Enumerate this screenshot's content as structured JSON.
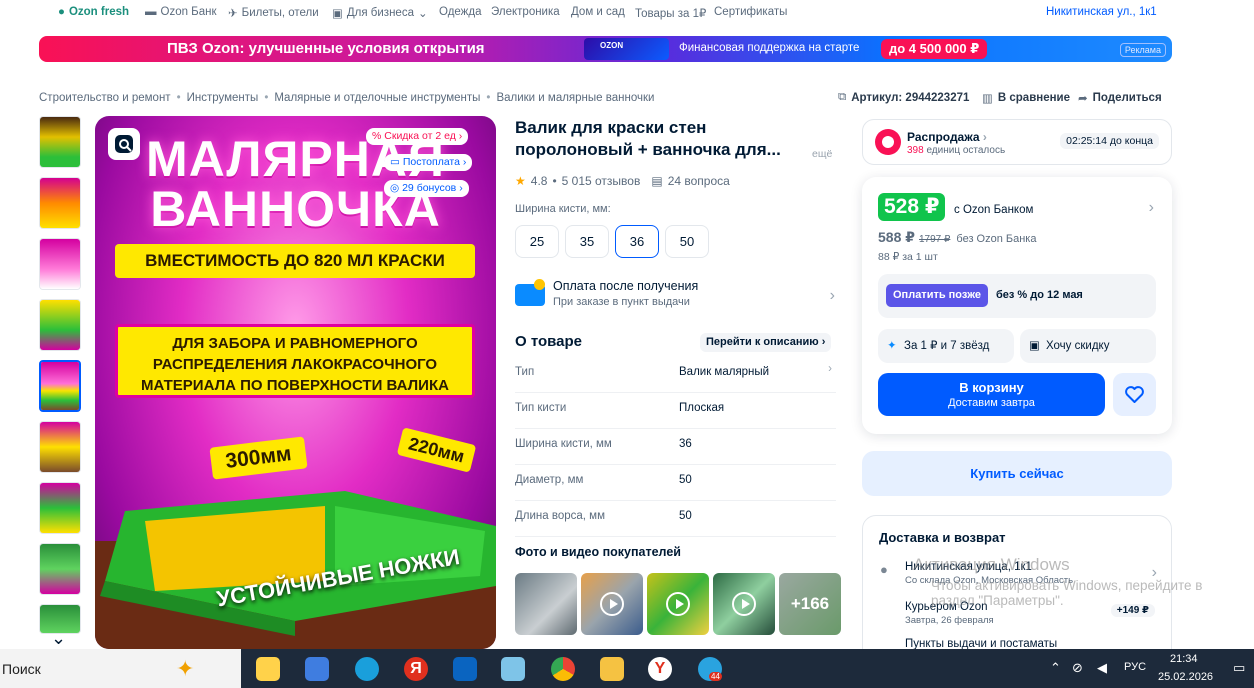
{
  "topnav": {
    "fresh": "Ozon fresh",
    "bank": "Ozon Банк",
    "tickets": "Билеты, отели",
    "business": "Для бизнеса",
    "clothes": "Одежда",
    "electronics": "Электроника",
    "home": "Дом и сад",
    "goods1": "Товары за 1₽",
    "certs": "Сертификаты",
    "address": "Никитинская ул., 1к1"
  },
  "banner": {
    "title": "ПВЗ Ozon: улучшенные условия открытия",
    "subtitle": "Финансовая поддержка на старте",
    "amount": "до 4 500 000 ₽",
    "ad": "Реклама",
    "deco": "OZON"
  },
  "breadcrumbs": [
    "Строительство и ремонт",
    "Инструменты",
    "Малярные и отделочные инструменты",
    "Валики и малярные ванночки"
  ],
  "actions": {
    "article": "Артикул: 2944223271",
    "compare": "В сравнение",
    "share": "Поделиться"
  },
  "gallery": {
    "headline1": "МАЛЯРНАЯ",
    "headline2": "ВАННОЧКА",
    "capacity": "ВМЕСТИМОСТЬ ДО 820 МЛ КРАСКИ",
    "purpose": "ДЛЯ ЗАБОРА И РАВНОМЕРНОГО РАСПРЕДЕЛЕНИЯ ЛАКОКРАСОЧНОГО МАТЕРИАЛА ПО ПОВЕРХНОСТИ ВАЛИКА",
    "size1": "300мм",
    "size2": "220мм",
    "legs": "УСТОЙЧИВЫЕ НОЖКИ",
    "tag_discount": "Скидка от 2 ед",
    "tag_postpay": "Постоплата",
    "tag_bonus": "29 бонусов"
  },
  "product": {
    "title": "Валик для краски стен поролоновый + ванночка для...",
    "more": "ещё",
    "rating": "4.8",
    "reviews": "5 015 отзывов",
    "questions": "24 вопроса",
    "width_label": "Ширина кисти, мм:",
    "sizes": [
      "25",
      "35",
      "36",
      "50"
    ],
    "pay_title": "Оплата после получения",
    "pay_sub": "При заказе в пункт выдачи",
    "about": "О товаре",
    "goto_desc": "Перейти к описанию",
    "specs": [
      {
        "k": "Тип",
        "v": "Валик малярный"
      },
      {
        "k": "Тип кисти",
        "v": "Плоская"
      },
      {
        "k": "Ширина кисти, мм",
        "v": "36"
      },
      {
        "k": "Диаметр, мм",
        "v": "50"
      },
      {
        "k": "Длина ворса, мм",
        "v": "50"
      }
    ],
    "photos_title": "Фото и видео покупателей",
    "photos_more": "+166"
  },
  "sale": {
    "title": "Распродажа",
    "left_count": "398",
    "left_text": "единиц осталось",
    "timer": "02:25:14 до конца"
  },
  "price": {
    "bank_price": "528 ₽",
    "bank_label": "с Ozon Банком",
    "price": "588 ₽",
    "old_price": "1797 ₽",
    "no_bank": "без Ozon Банка",
    "per_unit": "88 ₽ за 1 шт",
    "later_btn": "Оплатить позже",
    "later_text": "без % до 12 мая",
    "stars": "За 1 ₽ и 7 звёзд",
    "discount": "Хочу скидку",
    "cart": "В корзину",
    "cart_sub": "Доставим завтра",
    "buy_now": "Купить сейчас"
  },
  "delivery": {
    "title": "Доставка и возврат",
    "address": "Никитинская улица, 1к1",
    "address_sub": "Со склада Ozon, Московская Область",
    "courier": "Курьером Ozon",
    "courier_sub": "Завтра, 26 февраля",
    "courier_price": "+149 ₽",
    "pickup": "Пункты выдачи и постаматы"
  },
  "watermark": {
    "t1": "Активация Windows",
    "t2": "Чтобы активировать Windows, перейдите в",
    "t3": "раздел \"Параметры\"."
  },
  "taskbar": {
    "search": "Поиск",
    "lang": "РУС",
    "time": "21:34",
    "date": "25.02.2026",
    "badge": "44"
  }
}
